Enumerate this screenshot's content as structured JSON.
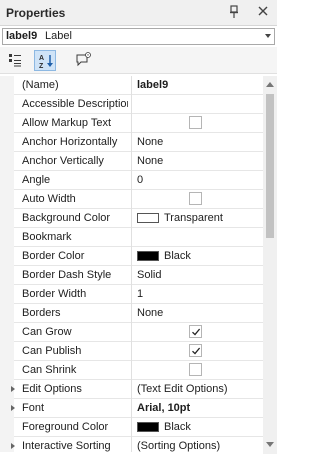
{
  "panel": {
    "title": "Properties",
    "pin_icon": "pin-icon",
    "close_icon": "close-icon"
  },
  "object_selector": {
    "name": "label9",
    "type": "Label"
  },
  "toolbar": {
    "buttons": [
      {
        "icon": "categorized-icon",
        "active": false
      },
      {
        "icon": "sort-alphabetical-icon",
        "active": true
      },
      {
        "icon": "comment-icon",
        "active": false
      }
    ]
  },
  "rows": [
    {
      "name": "(Name)",
      "value": "label9",
      "bold": true
    },
    {
      "name": "Accessible Description",
      "value": ""
    },
    {
      "name": "Allow Markup Text",
      "checkbox": false
    },
    {
      "name": "Anchor Horizontally",
      "value": "None"
    },
    {
      "name": "Anchor Vertically",
      "value": "None"
    },
    {
      "name": "Angle",
      "value": "0"
    },
    {
      "name": "Auto Width",
      "checkbox": false
    },
    {
      "name": "Background Color",
      "color": "#ffffff",
      "value": "Transparent"
    },
    {
      "name": "Bookmark",
      "value": ""
    },
    {
      "name": "Border Color",
      "color": "#000000",
      "value": "Black"
    },
    {
      "name": "Border Dash Style",
      "value": "Solid"
    },
    {
      "name": "Border Width",
      "value": "1"
    },
    {
      "name": "Borders",
      "value": "None"
    },
    {
      "name": "Can Grow",
      "checkbox": true
    },
    {
      "name": "Can Publish",
      "checkbox": true
    },
    {
      "name": "Can Shrink",
      "checkbox": false
    },
    {
      "name": "Edit Options",
      "value": "(Text Edit Options)",
      "expandable": true
    },
    {
      "name": "Font",
      "value": "Arial, 10pt",
      "bold": true,
      "expandable": true
    },
    {
      "name": "Foreground Color",
      "color": "#000000",
      "value": "Black"
    },
    {
      "name": "Interactive Sorting",
      "value": "(Sorting Options)",
      "expandable": true
    }
  ]
}
